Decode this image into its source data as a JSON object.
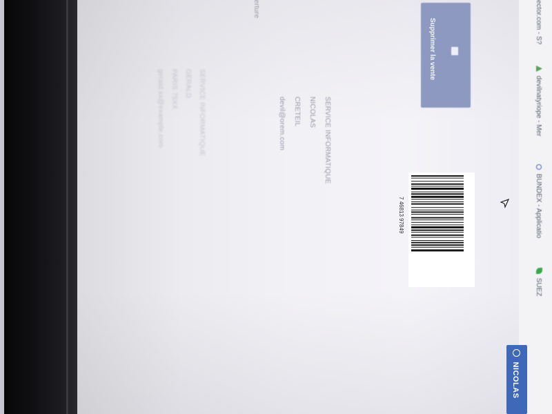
{
  "bookmarks": [
    {
      "label": "ector.com - S?",
      "color": "#c5c5cf"
    },
    {
      "label": "devilnatyriope - Mer",
      "color": "#5aa15a"
    },
    {
      "label": "BUNDEX - Applicatio",
      "color": "#4a66b0"
    },
    {
      "label": "SUEZ",
      "color": "#3aa84a"
    }
  ],
  "actions": {
    "delete_sale_label": "Supprimer la vente"
  },
  "section": {
    "truncated_heading": "verture"
  },
  "recipient": {
    "lines": [
      "SERVICE INFORMATIQUE",
      "NICOLAS",
      "CRETEIL",
      "devil@orem.com"
    ]
  },
  "sender": {
    "lines": [
      "SERVICE INFORMATIQUE",
      "GERALD",
      "PARIS 75XX",
      "gerald.xx@example.com"
    ]
  },
  "barcode": {
    "number": "7 46813 97849"
  },
  "user": {
    "name": "NICOLAS",
    "accent": "#3f68b8"
  }
}
